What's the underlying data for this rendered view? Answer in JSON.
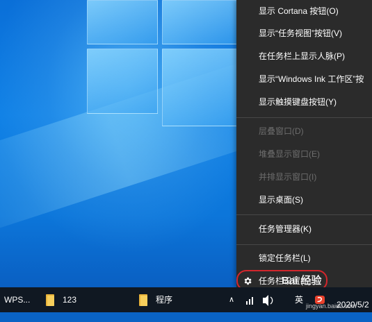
{
  "context_menu": {
    "items": [
      {
        "label": "显示 Cortana 按钮(O)",
        "enabled": true
      },
      {
        "label": "显示“任务视图”按钮(V)",
        "enabled": true
      },
      {
        "label": "在任务栏上显示人脉(P)",
        "enabled": true
      },
      {
        "label": "显示“Windows Ink 工作区”按",
        "enabled": true
      },
      {
        "label": "显示触摸键盘按钮(Y)",
        "enabled": true
      },
      {
        "label": "层叠窗口(D)",
        "enabled": false
      },
      {
        "label": "堆叠显示窗口(E)",
        "enabled": false
      },
      {
        "label": "并排显示窗口(I)",
        "enabled": false
      },
      {
        "label": "显示桌面(S)",
        "enabled": true
      },
      {
        "label": "任务管理器(K)",
        "enabled": true
      },
      {
        "label": "锁定任务栏(L)",
        "enabled": true
      },
      {
        "label": "任务栏设置(T)",
        "enabled": true,
        "icon": "gear-icon"
      }
    ]
  },
  "taskbar": {
    "items": [
      {
        "label": "WPS...",
        "icon": "wps-icon"
      },
      {
        "label": "123",
        "icon": "folder-icon"
      },
      {
        "label": "程序",
        "icon": "folder-icon"
      }
    ],
    "tray": {
      "chevron": "∧",
      "ime_label": "英",
      "clock_date": "2020/5/2"
    }
  },
  "watermark": {
    "text": "Bai 经验",
    "url": "jingyan.baidu.com"
  },
  "colors": {
    "menu_bg": "#2b2b2b",
    "disabled_text": "#6d6d6d",
    "highlight_ring": "#d4262c",
    "taskbar_bg": "#101822"
  }
}
